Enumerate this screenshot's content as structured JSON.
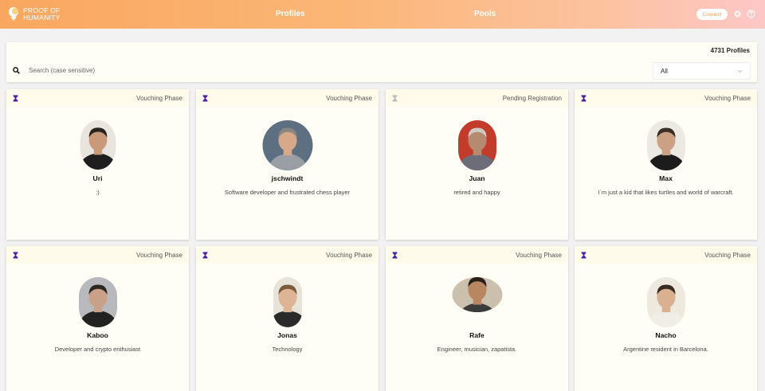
{
  "header": {
    "brand_line1": "PROOF OF",
    "brand_line2": "HUMANITY",
    "nav": [
      "Profiles",
      "Pools"
    ],
    "connect_label": "Connect",
    "gradient": [
      "#f9a75f",
      "#fdc7c7"
    ]
  },
  "search": {
    "count_label": "4731 Profiles",
    "placeholder": "Search (case sensitive)",
    "filter_value": "All"
  },
  "colors": {
    "phase_icon": "#4a1fa0",
    "phase_icon_pending": "#bbbbbb",
    "card_bg": "#fffef6"
  },
  "profiles": [
    {
      "status": "Vouching Phase",
      "name": "Uri",
      "bio": ":)",
      "pending": false
    },
    {
      "status": "Vouching Phase",
      "name": "jschwindt",
      "bio": "Software developer and frustrated chess player",
      "pending": false
    },
    {
      "status": "Pending Registration",
      "name": "Juan",
      "bio": "retired and happy",
      "pending": true
    },
    {
      "status": "Vouching Phase",
      "name": "Max",
      "bio": "I´m just a kid that likes turtles and world of warcraft.",
      "pending": false
    },
    {
      "status": "Vouching Phase",
      "name": "Kaboo",
      "bio": "Developer and crypto enthusiast",
      "pending": false
    },
    {
      "status": "Vouching Phase",
      "name": "Jonas",
      "bio": "Technology",
      "pending": false
    },
    {
      "status": "Vouching Phase",
      "name": "Rafe",
      "bio": "Engineer, musician, zapatista.",
      "pending": false
    },
    {
      "status": "Vouching Phase",
      "name": "Nacho",
      "bio": "Argentine resident in Barcelona.",
      "pending": false
    }
  ]
}
